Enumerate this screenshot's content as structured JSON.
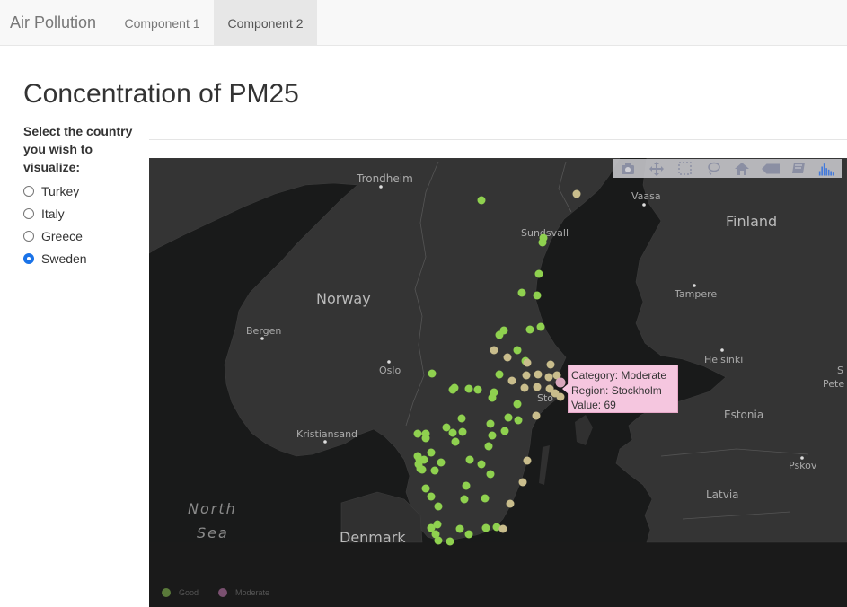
{
  "navbar": {
    "brand": "Air Pollution",
    "tabs": [
      {
        "label": "Component 1",
        "active": false
      },
      {
        "label": "Component 2",
        "active": true
      }
    ]
  },
  "main": {
    "title": "Concentration of PM25",
    "prompt": "Select the country you wish to visualize:",
    "countries": [
      {
        "label": "Turkey",
        "checked": false
      },
      {
        "label": "Italy",
        "checked": false
      },
      {
        "label": "Greece",
        "checked": false
      },
      {
        "label": "Sweden",
        "checked": true
      }
    ]
  },
  "map": {
    "labels": {
      "trondheim": "Trondheim",
      "vaasa": "Vaasa",
      "finland": "Finland",
      "sundsvall": "Sundsvall",
      "norway": "Norway",
      "tampere": "Tampere",
      "bergen": "Bergen",
      "oslo": "Oslo",
      "helsinki": "Helsinki",
      "s_edge": "S",
      "pete": "Pete",
      "stockholm_partial": "Sto",
      "estonia": "Estonia",
      "kristiansand": "Kristiansand",
      "pskov": "Pskov",
      "latvia": "Latvia",
      "north": "North",
      "sea": "Sea",
      "denmark": "Denmark"
    },
    "categories": [
      {
        "name": "Good",
        "color": "#8fd14f"
      },
      {
        "name": "Moderate",
        "color": "#c9bd8c"
      }
    ],
    "legend": [
      {
        "label": "Good",
        "color": "#5a7a3a"
      },
      {
        "label": "Moderate",
        "color": "#7a5070"
      }
    ],
    "tooltip": {
      "category": "Category: Moderate",
      "region": "Region: Stockholm",
      "value": "Value: 69"
    }
  },
  "modebar": {
    "buttons": [
      "camera-icon",
      "pan-icon",
      "box-select-icon",
      "lasso-icon",
      "home-icon",
      "hover-closest-icon",
      "hover-compare-icon",
      "plotly-logo-icon"
    ]
  }
}
